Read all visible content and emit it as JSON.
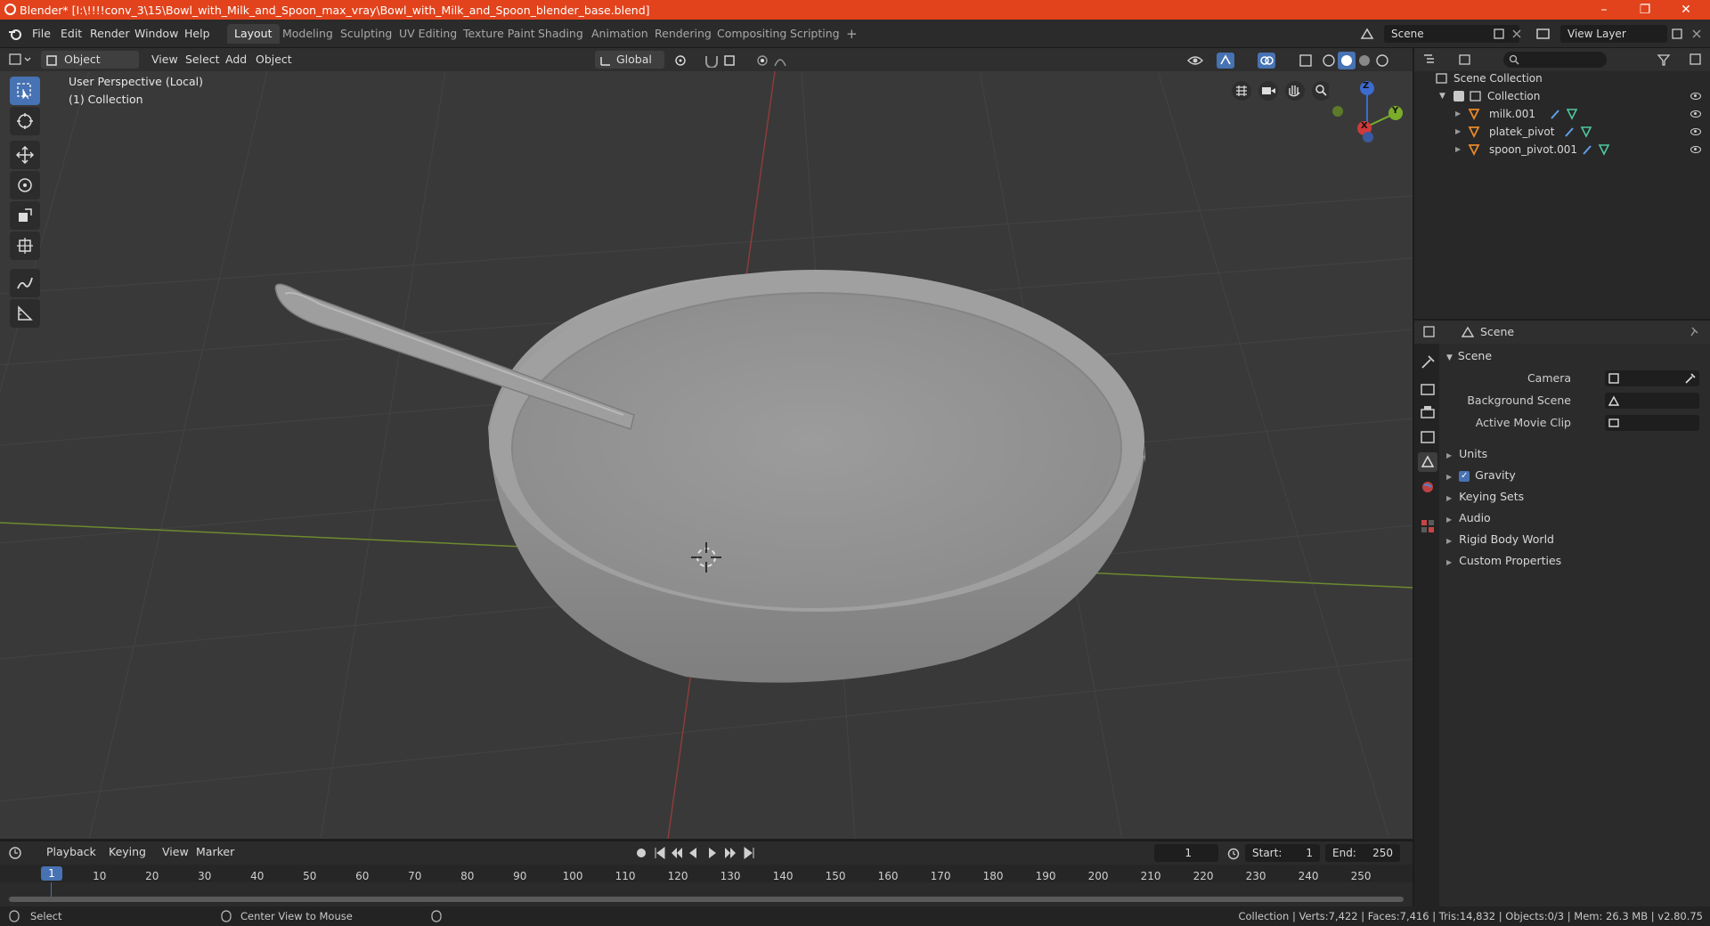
{
  "window": {
    "title": "Blender* [I:\\!!!!conv_3\\15\\Bowl_with_Milk_and_Spoon_max_vray\\Bowl_with_Milk_and_Spoon_blender_base.blend]",
    "minimize": "–",
    "maximize": "❐",
    "close": "✕"
  },
  "menu": [
    "File",
    "Edit",
    "Render",
    "Window",
    "Help"
  ],
  "workspaces": [
    {
      "label": "Layout",
      "active": true
    },
    {
      "label": "Modeling"
    },
    {
      "label": "Sculpting"
    },
    {
      "label": "UV Editing"
    },
    {
      "label": "Texture Paint"
    },
    {
      "label": "Shading"
    },
    {
      "label": "Animation"
    },
    {
      "label": "Rendering"
    },
    {
      "label": "Compositing"
    },
    {
      "label": "Scripting"
    }
  ],
  "add_workspace": "+",
  "scene_name": "Scene",
  "view_layer": "View Layer",
  "viewport_header": {
    "mode": "Object Mode",
    "menus": [
      "View",
      "Select",
      "Add",
      "Object"
    ],
    "orientation": "Global"
  },
  "viewport": {
    "perspective": "User Perspective (Local)",
    "collection": "(1) Collection",
    "gizmo": {
      "z": "Z",
      "y": "Y",
      "x": "X"
    }
  },
  "outliner": {
    "root": "Scene Collection",
    "collection": "Collection",
    "objects": [
      "milk.001",
      "platek_pivot",
      "spoon_pivot.001"
    ]
  },
  "properties": {
    "context": "Scene",
    "panel_title": "Scene",
    "fields": [
      {
        "label": "Camera"
      },
      {
        "label": "Background Scene"
      },
      {
        "label": "Active Movie Clip"
      }
    ],
    "sections": [
      "Units",
      "Gravity",
      "Keying Sets",
      "Audio",
      "Rigid Body World",
      "Custom Properties"
    ],
    "gravity_enabled": true
  },
  "timeline": {
    "menus": [
      "Playback",
      "Keying",
      "View",
      "Marker"
    ],
    "current_frame": "1",
    "start_label": "Start:",
    "start": "1",
    "end_label": "End:",
    "end": "250",
    "ticks": [
      "1",
      "10",
      "20",
      "30",
      "40",
      "50",
      "60",
      "70",
      "80",
      "90",
      "100",
      "110",
      "120",
      "130",
      "140",
      "150",
      "160",
      "170",
      "180",
      "190",
      "200",
      "210",
      "220",
      "230",
      "240",
      "250"
    ]
  },
  "status": {
    "left_action": "Select",
    "middle_action": "Center View to Mouse",
    "stats": "Collection | Verts:7,422 | Faces:7,416 | Tris:14,832 | Objects:0/3 | Mem: 26.3 MB | v2.80.75"
  },
  "colors": {
    "titlebar": "#e2431c",
    "accent": "#4772b3",
    "object_icon": "#e8892a",
    "modifier_icon": "#5fa0e8",
    "mesh_icon": "#4ec9a0"
  }
}
